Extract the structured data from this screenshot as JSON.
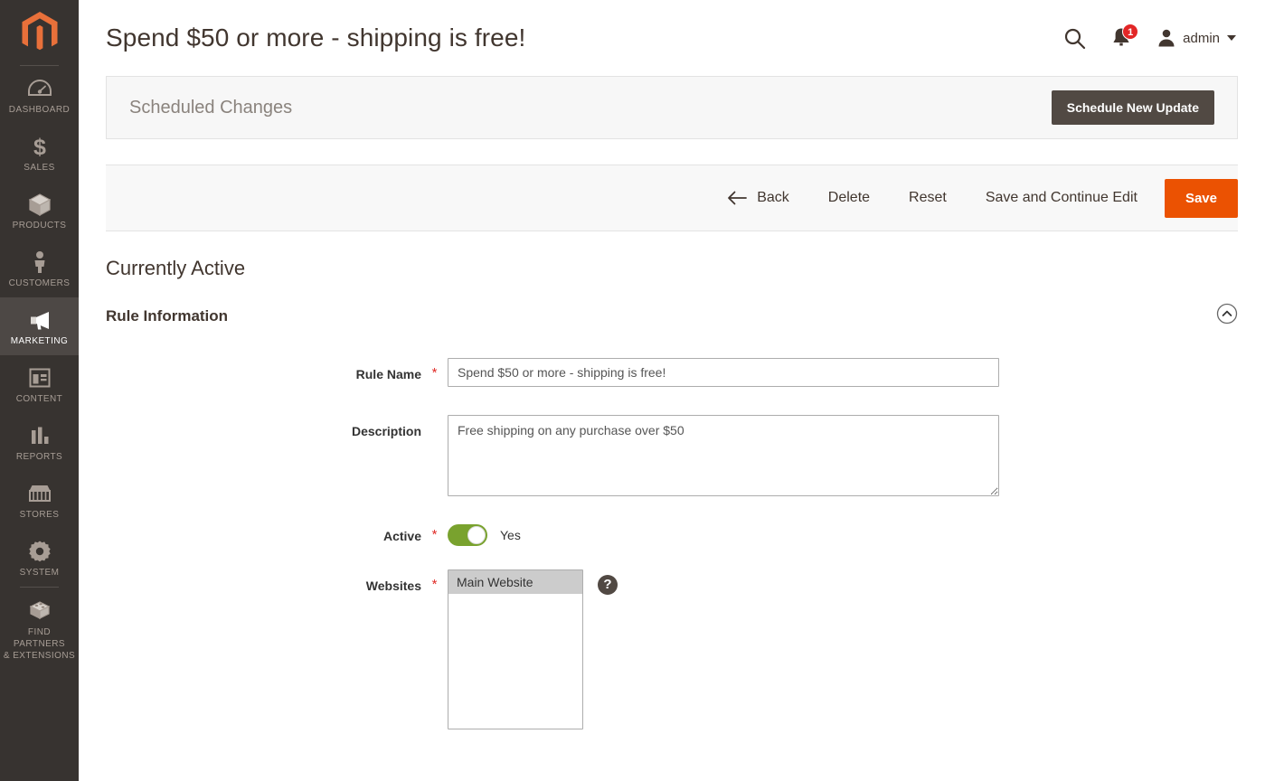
{
  "brand": {
    "logo_name": "magento-logo",
    "accent": "#e8703a"
  },
  "sidebar": {
    "items": [
      {
        "label": "DASHBOARD",
        "icon": "dashboard-icon",
        "active": false
      },
      {
        "label": "SALES",
        "icon": "dollar-icon",
        "active": false
      },
      {
        "label": "PRODUCTS",
        "icon": "box-icon",
        "active": false
      },
      {
        "label": "CUSTOMERS",
        "icon": "person-icon",
        "active": false
      },
      {
        "label": "MARKETING",
        "icon": "megaphone-icon",
        "active": true
      },
      {
        "label": "CONTENT",
        "icon": "layout-icon",
        "active": false
      },
      {
        "label": "REPORTS",
        "icon": "bar-chart-icon",
        "active": false
      },
      {
        "label": "STORES",
        "icon": "storefront-icon",
        "active": false
      },
      {
        "label": "SYSTEM",
        "icon": "gear-icon",
        "active": false
      },
      {
        "label": "FIND PARTNERS\n& EXTENSIONS",
        "label_line1": "FIND PARTNERS",
        "label_line2": "& EXTENSIONS",
        "icon": "puzzle-block-icon",
        "active": false
      }
    ]
  },
  "header": {
    "title": "Spend $50 or more - shipping is free!",
    "search_icon": "search-icon",
    "notifications_icon": "bell-icon",
    "notifications_count": "1",
    "user_icon": "user-avatar-icon",
    "user_name": "admin"
  },
  "scheduled_changes": {
    "title": "Scheduled Changes",
    "schedule_button": "Schedule New Update"
  },
  "toolbar": {
    "back": "Back",
    "back_icon": "arrow-left-icon",
    "delete": "Delete",
    "reset": "Reset",
    "save_continue": "Save and Continue Edit",
    "save": "Save",
    "save_color": "#eb5202"
  },
  "status": {
    "text": "Currently Active"
  },
  "section": {
    "title": "Rule Information",
    "collapse_icon": "chevron-up-circle-icon"
  },
  "form": {
    "rule_name": {
      "label": "Rule Name",
      "required": "*",
      "value": "Spend $50 or more - shipping is free!",
      "placeholder": ""
    },
    "description": {
      "label": "Description",
      "required": "",
      "value": "Free shipping on any purchase over $50",
      "placeholder": ""
    },
    "active": {
      "label": "Active",
      "required": "*",
      "state": "Yes",
      "toggle_on": true,
      "on_color": "#79a22e"
    },
    "websites": {
      "label": "Websites",
      "required": "*",
      "options": [
        "Main Website"
      ],
      "selected": "Main Website",
      "help_icon": "help-question-icon"
    }
  }
}
